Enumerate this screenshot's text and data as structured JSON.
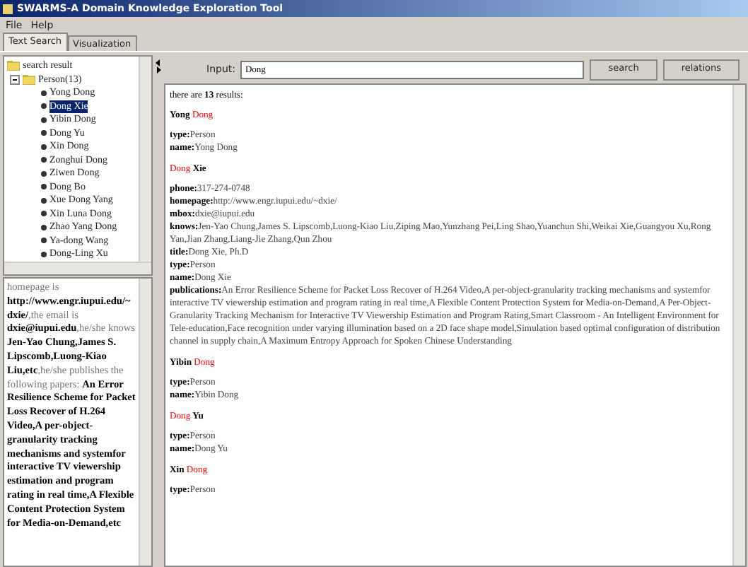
{
  "window": {
    "title": "SWARMS-A Domain Knowledge Exploration Tool"
  },
  "menu": [
    "File",
    "Help"
  ],
  "tabs": [
    {
      "label": "Text Search",
      "selected": true
    },
    {
      "label": "Visualization",
      "selected": false
    }
  ],
  "tree": {
    "label": "search result",
    "children": [
      {
        "label": "Person(13)",
        "expanded": true,
        "children": [
          {
            "label": "Yong Dong",
            "selected": false
          },
          {
            "label": "Dong Xie",
            "selected": true
          },
          {
            "label": "Yibin Dong",
            "selected": false
          },
          {
            "label": "Dong Yu",
            "selected": false
          },
          {
            "label": "Xin Dong",
            "selected": false
          },
          {
            "label": "Zonghui Dong",
            "selected": false
          },
          {
            "label": "Ziwen Dong",
            "selected": false
          },
          {
            "label": "Dong Bo",
            "selected": false
          },
          {
            "label": "Xue Dong Yang",
            "selected": false
          },
          {
            "label": "Xin Luna Dong",
            "selected": false
          },
          {
            "label": "Zhao Yang Dong",
            "selected": false
          },
          {
            "label": "Ya-dong Wang",
            "selected": false
          },
          {
            "label": "Dong-Ling Xu",
            "selected": false
          }
        ]
      }
    ]
  },
  "summary": "homepage is **http://www.engr.iupui.edu/~dxie/**,the email is **dxie@iupui.edu**,he/she knows **Jen-Yao Chung,James S. Lipscomb,Luong-Kiao Liu,etc**,he/she publishes the following papers: **An Error Resilience Scheme for Packet Loss Recover of H.264 Video,A per-object-granularity tracking mechanisms and systemfor interactive TV viewership estimation and program rating in real time,A Flexible Content Protection System for Media-on-Demand,etc**",
  "search": {
    "label": "Input:",
    "value": "Dong"
  },
  "buttons": [
    "search",
    "relations"
  ],
  "results_count": "there are **13** results:",
  "results": [
    {
      "heading": [
        {
          "text": "Yong",
          "highlight": false
        },
        {
          "text": "Dong",
          "highlight": true
        }
      ],
      "fields": [
        {
          "label": "type:",
          "value": "Person"
        },
        {
          "label": "name:",
          "value": "Yong Dong"
        }
      ]
    },
    {
      "heading": [
        {
          "text": "Dong",
          "highlight": true
        },
        {
          "text": "Xie",
          "highlight": false
        }
      ],
      "fields": [
        {
          "label": "phone:",
          "value": "317-274-0748"
        },
        {
          "label": "homepage:",
          "value": "http://www.engr.iupui.edu/~dxie/"
        },
        {
          "label": "mbox:",
          "value": "dxie@iupui.edu"
        },
        {
          "label": "knows:",
          "value": "Jen-Yao Chung,James S. Lipscomb,Luong-Kiao Liu,Ziping Mao,Yunzhang Pei,Ling Shao,Yuanchun Shi,Weikai Xie,Guangyou Xu,Rong Yan,Jian Zhang,Liang-Jie Zhang,Qun Zhou"
        },
        {
          "label": "title:",
          "value": "Dong Xie, Ph.D"
        },
        {
          "label": "type:",
          "value": "Person"
        },
        {
          "label": "name:",
          "value": "Dong Xie"
        },
        {
          "label": "publications:",
          "value": "An Error Resilience Scheme for Packet Loss Recover of H.264 Video,A per-object-granularity tracking mechanisms and systemfor interactive TV viewership estimation and program rating in real time,A Flexible Content Protection System for Media-on-Demand,A Per-Object-Granularity Tracking Mechanism for Interactive TV Viewership Estimation and Program Rating,Smart Classroom - An Intelligent Environment for Tele-education,Face recognition under varying illumination based on a 2D face shape model,Simulation based optimal configuration of distribution channel in supply chain,A Maximum Entropy Approach for Spoken Chinese Understanding"
        }
      ]
    },
    {
      "heading": [
        {
          "text": "Yibin",
          "highlight": false
        },
        {
          "text": "Dong",
          "highlight": true
        }
      ],
      "fields": [
        {
          "label": "type:",
          "value": "Person"
        },
        {
          "label": "name:",
          "value": "Yibin Dong"
        }
      ]
    },
    {
      "heading": [
        {
          "text": "Dong",
          "highlight": true
        },
        {
          "text": "Yu",
          "highlight": false
        }
      ],
      "fields": [
        {
          "label": "type:",
          "value": "Person"
        },
        {
          "label": "name:",
          "value": "Dong Yu"
        }
      ]
    },
    {
      "heading": [
        {
          "text": "Xin",
          "highlight": false
        },
        {
          "text": "Dong",
          "highlight": true
        }
      ],
      "fields": [
        {
          "label": "type:",
          "value": "Person"
        }
      ]
    }
  ]
}
